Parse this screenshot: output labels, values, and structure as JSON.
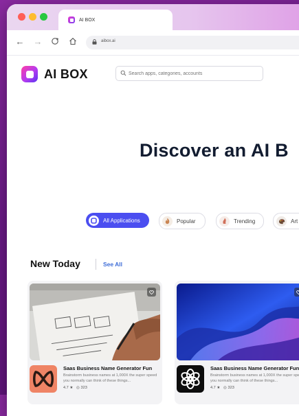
{
  "browser": {
    "tab_title": "AI BOX",
    "url": "aibox.ai"
  },
  "header": {
    "logo_text": "AI BOX",
    "search_placeholder": "Search apps, categories, accounts"
  },
  "hero": {
    "title": "Discover an AI B"
  },
  "categories": [
    {
      "label": "All Applications",
      "active": true,
      "icon": "grid-icon"
    },
    {
      "label": "Popular",
      "active": false,
      "icon": "flame-icon"
    },
    {
      "label": "Trending",
      "active": false,
      "icon": "trending-icon"
    },
    {
      "label": "Art",
      "active": false,
      "icon": "art-icon"
    }
  ],
  "section": {
    "title": "New Today",
    "see_all": "See All"
  },
  "cards": [
    {
      "title": "Saas Business Name Generator Fun",
      "description": "Brainstorm business names at 1,000X the super speed you normally can think of these things...",
      "rating": "4.7 ★",
      "views": "◎ 323",
      "image": "wireframe-sketch-photo",
      "icon": "knot-logo-icon"
    },
    {
      "title": "Saas Business Name Generator Fun",
      "description": "Brainstorm business names at 1,000X the super speed you normally can think of these things...",
      "rating": "4.7 ★",
      "views": "◎ 323",
      "image": "blue-abstract-waves",
      "icon": "openai-logo-icon"
    }
  ],
  "colors": {
    "accent": "#4b4ef0",
    "link": "#3f6ed8",
    "background": "#6a1a86"
  }
}
